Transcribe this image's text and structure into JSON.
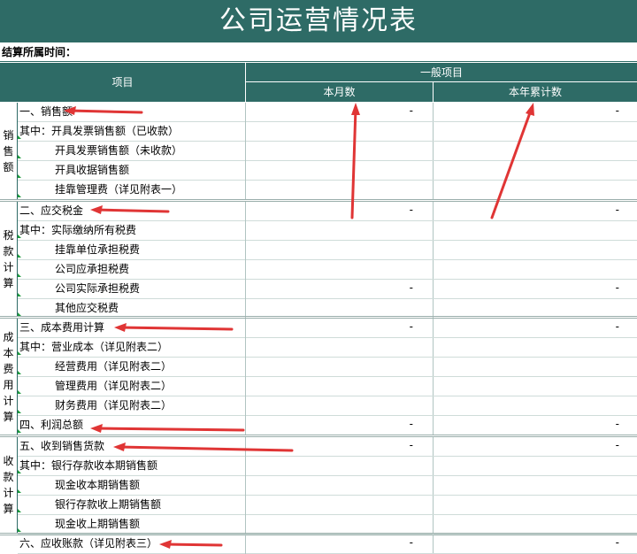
{
  "title": "公司运营情况表",
  "period_label": "结算所属时间：",
  "header": {
    "item": "项目",
    "general": "一般项目",
    "month": "本月数",
    "year": "本年累计数"
  },
  "categories": {
    "sales": "销售额",
    "tax": "税款计算",
    "cost": "成本费用计算",
    "collect": "收款计算"
  },
  "rows": {
    "r1": {
      "label": "一、销售额",
      "month": "-",
      "year": "-"
    },
    "r2": {
      "label": "其中：开具发票销售额（已收款）"
    },
    "r3": {
      "label": "开具发票销售额（未收款）"
    },
    "r4": {
      "label": "开具收据销售额"
    },
    "r5": {
      "label": "挂靠管理费（详见附表一）"
    },
    "r6": {
      "label": "二、应交税金",
      "month": "-",
      "year": "-"
    },
    "r7": {
      "label": "其中：实际缴纳所有税费"
    },
    "r8": {
      "label": "挂靠单位承担税费"
    },
    "r9": {
      "label": "公司应承担税费"
    },
    "r10": {
      "label": "公司实际承担税费",
      "month": "-",
      "year": "-"
    },
    "r11": {
      "label": "其他应交税费"
    },
    "r12": {
      "label": "三、成本费用计算",
      "month": "-",
      "year": "-"
    },
    "r13": {
      "label": "其中：营业成本（详见附表二）"
    },
    "r14": {
      "label": "经营费用（详见附表二）"
    },
    "r15": {
      "label": "管理费用（详见附表二）"
    },
    "r16": {
      "label": "财务费用（详见附表二）"
    },
    "r17": {
      "label": "四、利润总额",
      "month": "-",
      "year": "-"
    },
    "r18": {
      "label": "五、收到销售货款",
      "month": "-",
      "year": "-"
    },
    "r19": {
      "label": "其中：银行存款收本期销售额"
    },
    "r20": {
      "label": "现金收本期销售额"
    },
    "r21": {
      "label": "银行存款收上期销售额"
    },
    "r22": {
      "label": "现金收上期销售额"
    },
    "r23": {
      "label": "六、应收账款（详见附表三）",
      "month": "-",
      "year": "-"
    }
  },
  "annotation_color": "#e03535",
  "theme_color": "#2e6b66"
}
